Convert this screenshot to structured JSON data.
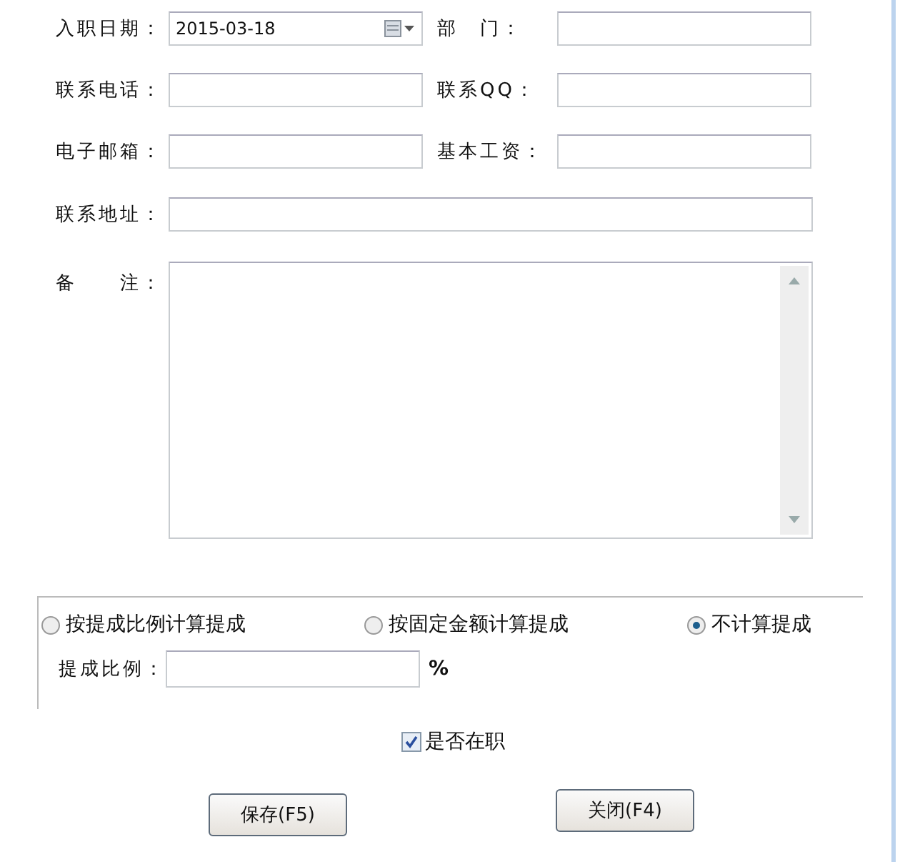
{
  "fields": [
    {
      "label": "入职日期：",
      "value": "2015-03-18",
      "kind": "date"
    },
    {
      "label": "部　门：",
      "kind": "text"
    },
    {
      "label": "联系电话：",
      "kind": "text"
    },
    {
      "label": "联系QQ：",
      "kind": "text"
    },
    {
      "label": "电子邮箱：",
      "kind": "text"
    },
    {
      "label": "基本工资：",
      "kind": "text"
    }
  ],
  "address": {
    "label": "联系地址："
  },
  "notes": {
    "label": "备　　注："
  },
  "commission": {
    "options": [
      {
        "label": "按提成比例计算提成",
        "selected": false
      },
      {
        "label": "按固定金额计算提成",
        "selected": false
      },
      {
        "label": "不计算提成",
        "selected": true
      }
    ],
    "ratio_label": "提成比例：",
    "ratio_unit": "%"
  },
  "employed": {
    "label": "是否在职",
    "checked": true
  },
  "buttons": [
    "保存(F5)",
    "关闭(F4)"
  ]
}
